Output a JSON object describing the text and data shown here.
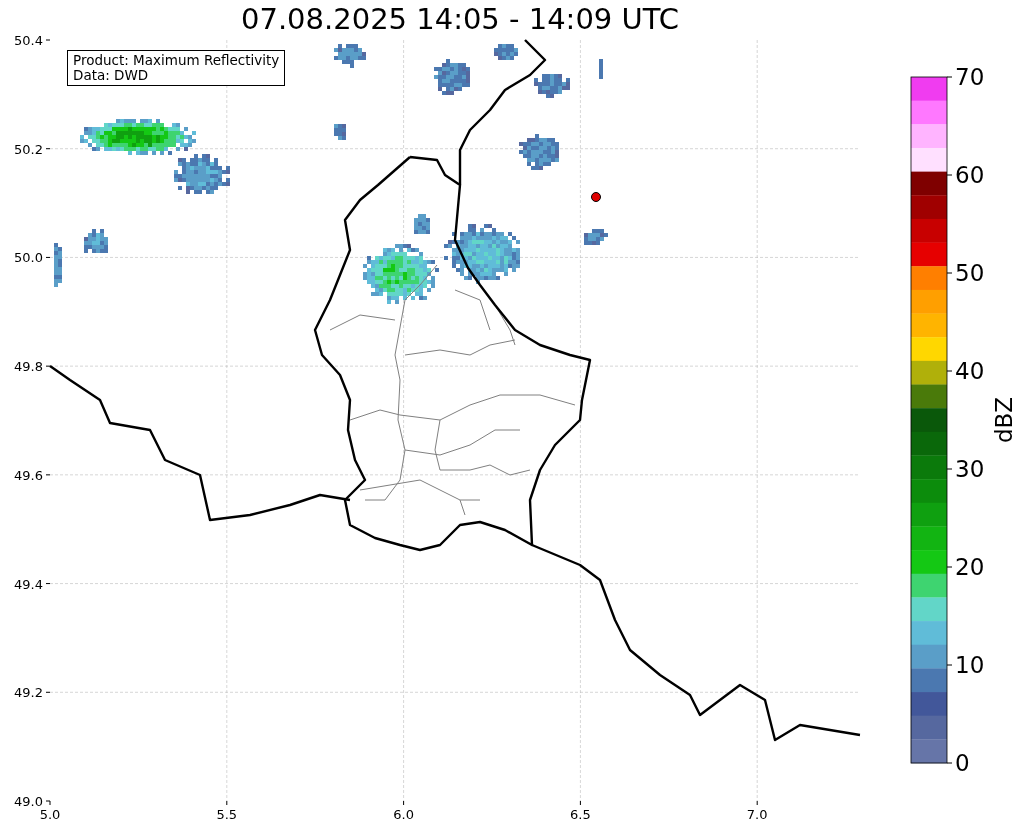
{
  "title": "07.08.2025 14:05 - 14:09 UTC",
  "info_box": [
    "Product: Maximum Reflectivity",
    "Data: DWD"
  ],
  "x_ticks": [
    "5.0",
    "5.5",
    "6.0",
    "6.5",
    "7.0"
  ],
  "y_ticks": [
    "50.4",
    "50.2",
    "50.0",
    "49.8",
    "49.6",
    "49.4",
    "49.2",
    "49.0"
  ],
  "colorbar": {
    "label": "dBZ",
    "ticks": [
      "70",
      "60",
      "50",
      "40",
      "30",
      "20",
      "10",
      "0"
    ],
    "bands": [
      {
        "color": "#f03cf0"
      },
      {
        "color": "#ff78ff"
      },
      {
        "color": "#ffb4ff"
      },
      {
        "color": "#ffe0ff"
      },
      {
        "color": "#7f0000"
      },
      {
        "color": "#a00000"
      },
      {
        "color": "#c80000"
      },
      {
        "color": "#e60000"
      },
      {
        "color": "#ff7f00"
      },
      {
        "color": "#ff9f00"
      },
      {
        "color": "#ffb400"
      },
      {
        "color": "#ffd700"
      },
      {
        "color": "#b0b00a"
      },
      {
        "color": "#4a7a0a"
      },
      {
        "color": "#0a580a"
      },
      {
        "color": "#0a680a"
      },
      {
        "color": "#0b7a0b"
      },
      {
        "color": "#0c8c0c"
      },
      {
        "color": "#0fa010"
      },
      {
        "color": "#12b412"
      },
      {
        "color": "#14c814"
      },
      {
        "color": "#3ed470"
      },
      {
        "color": "#62d6c8"
      },
      {
        "color": "#60bcd8"
      },
      {
        "color": "#5a9ec8"
      },
      {
        "color": "#4b78b0"
      },
      {
        "color": "#42579a"
      },
      {
        "color": "#56689f"
      },
      {
        "color": "#6675a8"
      }
    ]
  }
}
